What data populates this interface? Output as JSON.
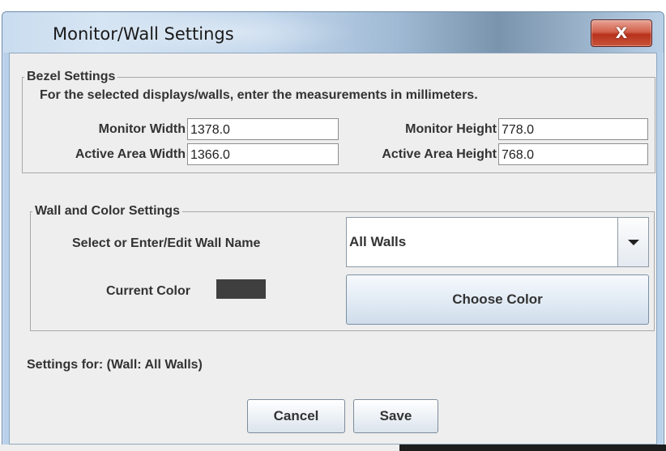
{
  "window": {
    "title": "Monitor/Wall Settings",
    "close_glyph": "X"
  },
  "bezel": {
    "legend": "Bezel Settings",
    "instruction": "For the selected displays/walls, enter the measurements in millimeters.",
    "monitor_width_label": "Monitor Width",
    "monitor_width_value": "1378.0",
    "monitor_height_label": "Monitor Height",
    "monitor_height_value": "778.0",
    "active_width_label": "Active Area Width",
    "active_width_value": "1366.0",
    "active_height_label": "Active Area Height",
    "active_height_value": "768.0"
  },
  "wall": {
    "legend": "Wall and Color Settings",
    "select_label": "Select or Enter/Edit Wall Name",
    "selected_wall": "All Walls",
    "current_color_label": "Current Color",
    "current_color": "#3f3f3f",
    "choose_color_label": "Choose Color"
  },
  "status": {
    "settings_for": "Settings for: (Wall: All Walls)"
  },
  "buttons": {
    "cancel": "Cancel",
    "save": "Save"
  }
}
